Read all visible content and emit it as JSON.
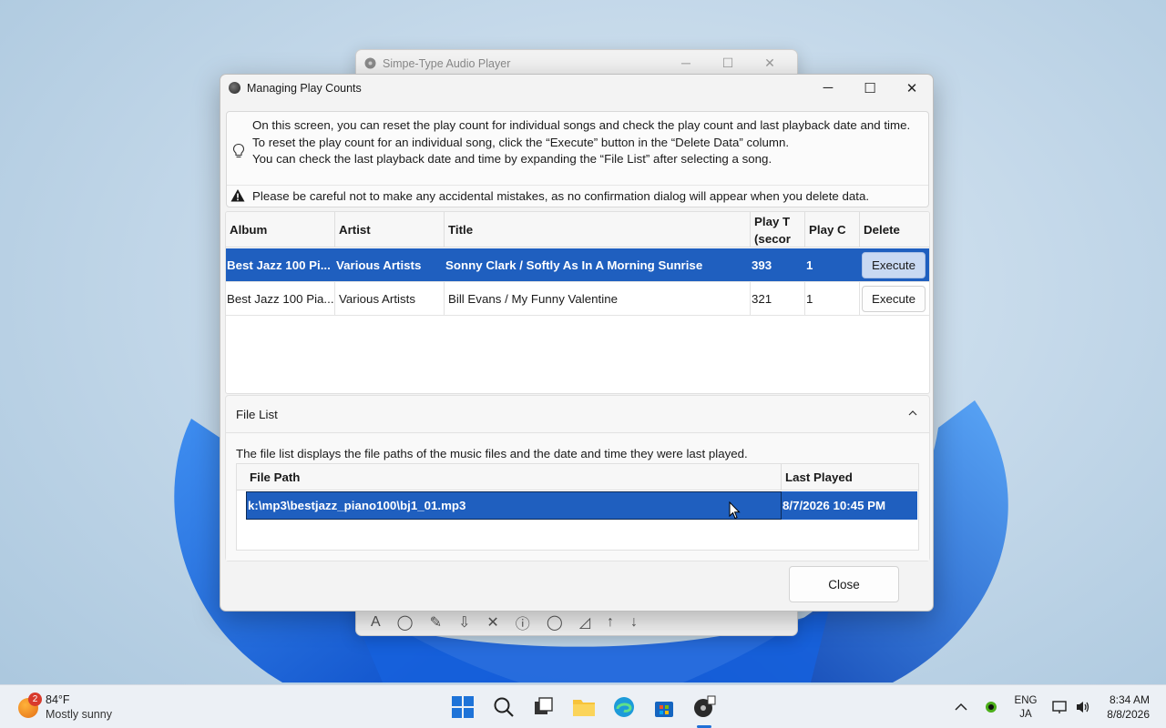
{
  "background_window": {
    "title": "Simpe-Type Audio Player"
  },
  "dialog": {
    "title": "Managing Play Counts",
    "info_lines": [
      "On this screen, you can reset the play count for individual songs and check the play count and last playback date and time.",
      "To reset the play count for an individual song, click the “Execute” button in the “Delete Data” column.",
      "You can check the last playback date and time by expanding the “File List” after selecting a song."
    ],
    "warning": "Please be careful not to make any accidental mistakes, as no confirmation dialog will appear when you delete data.",
    "columns": {
      "album": "Album",
      "artist": "Artist",
      "title": "Title",
      "play_time": "Play T (secor",
      "play_count": "Play C",
      "delete": "Delete"
    },
    "rows": [
      {
        "album": "Best Jazz 100 Pi...",
        "artist": "Various Artists",
        "title": "Sonny Clark / Softly As In A Morning Sunrise",
        "play_time": "393",
        "play_count": "1",
        "execute": "Execute",
        "selected": true
      },
      {
        "album": "Best Jazz 100 Pia...",
        "artist": "Various Artists",
        "title": "Bill Evans / My Funny Valentine",
        "play_time": "321",
        "play_count": "1",
        "execute": "Execute",
        "selected": false
      }
    ],
    "file_list": {
      "header": "File List",
      "description": "The file list displays the file paths of the music files and the date and time they were last played.",
      "columns": {
        "path": "File Path",
        "last_played": "Last Played"
      },
      "rows": [
        {
          "path": "k:\\mp3\\bestjazz_piano100\\bj1_01.mp3",
          "last_played": "8/7/2026 10:45 PM"
        }
      ]
    },
    "close_label": "Close"
  },
  "taskbar": {
    "weather_badge": "2",
    "temperature": "84°F",
    "condition": "Mostly sunny",
    "lang_top": "ENG",
    "lang_bottom": "JA",
    "time": "8:34 AM",
    "date": "8/8/2026"
  },
  "colors": {
    "selection": "#1f5fbf",
    "dialog_bg": "#f3f3f3",
    "taskbar_bg": "#ecf0f5"
  }
}
